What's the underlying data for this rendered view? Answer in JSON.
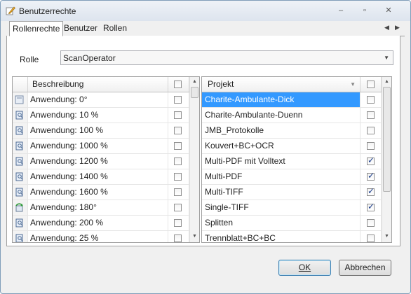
{
  "window": {
    "title": "Benutzerrechte",
    "minimize_label": "–",
    "maximize_label": "▫",
    "close_label": "✕"
  },
  "tabs": [
    {
      "label": "Rollenrechte",
      "active": true
    },
    {
      "label": "Benutzer",
      "active": false
    },
    {
      "label": "Rollen",
      "active": false
    }
  ],
  "rolle": {
    "label": "Rolle",
    "value": "ScanOperator"
  },
  "left_grid": {
    "header": "Beschreibung",
    "rows": [
      {
        "label": "Anwendung: 0°",
        "icon": "page-icon",
        "checked": false
      },
      {
        "label": "Anwendung: 10 %",
        "icon": "scan-icon",
        "checked": false
      },
      {
        "label": "Anwendung: 100 %",
        "icon": "scan-icon",
        "checked": false
      },
      {
        "label": "Anwendung: 1000 %",
        "icon": "scan-icon",
        "checked": false
      },
      {
        "label": "Anwendung: 1200 %",
        "icon": "scan-icon",
        "checked": false
      },
      {
        "label": "Anwendung: 1400 %",
        "icon": "scan-icon",
        "checked": false
      },
      {
        "label": "Anwendung: 1600 %",
        "icon": "scan-icon",
        "checked": false
      },
      {
        "label": "Anwendung: 180°",
        "icon": "rotate-icon",
        "checked": false
      },
      {
        "label": "Anwendung: 200 %",
        "icon": "scan-icon",
        "checked": false
      },
      {
        "label": "Anwendung: 25 %",
        "icon": "scan-icon",
        "checked": false
      }
    ]
  },
  "right_grid": {
    "header": "Projekt",
    "rows": [
      {
        "label": "Charite-Ambulante-Dick",
        "checked": false,
        "selected": true
      },
      {
        "label": "Charite-Ambulante-Duenn",
        "checked": false,
        "selected": false
      },
      {
        "label": "JMB_Protokolle",
        "checked": false,
        "selected": false
      },
      {
        "label": "Kouvert+BC+OCR",
        "checked": false,
        "selected": false
      },
      {
        "label": "Multi-PDF mit Volltext",
        "checked": true,
        "selected": false
      },
      {
        "label": "Multi-PDF",
        "checked": true,
        "selected": false
      },
      {
        "label": "Multi-TIFF",
        "checked": true,
        "selected": false
      },
      {
        "label": "Single-TIFF",
        "checked": true,
        "selected": false
      },
      {
        "label": "Splitten",
        "checked": false,
        "selected": false
      },
      {
        "label": "Trennblatt+BC+BC",
        "checked": false,
        "selected": false
      }
    ]
  },
  "buttons": {
    "ok": "OK",
    "cancel": "Abbrechen"
  },
  "colors": {
    "selection": "#3399ff",
    "accent_border": "#3c7fb1"
  }
}
